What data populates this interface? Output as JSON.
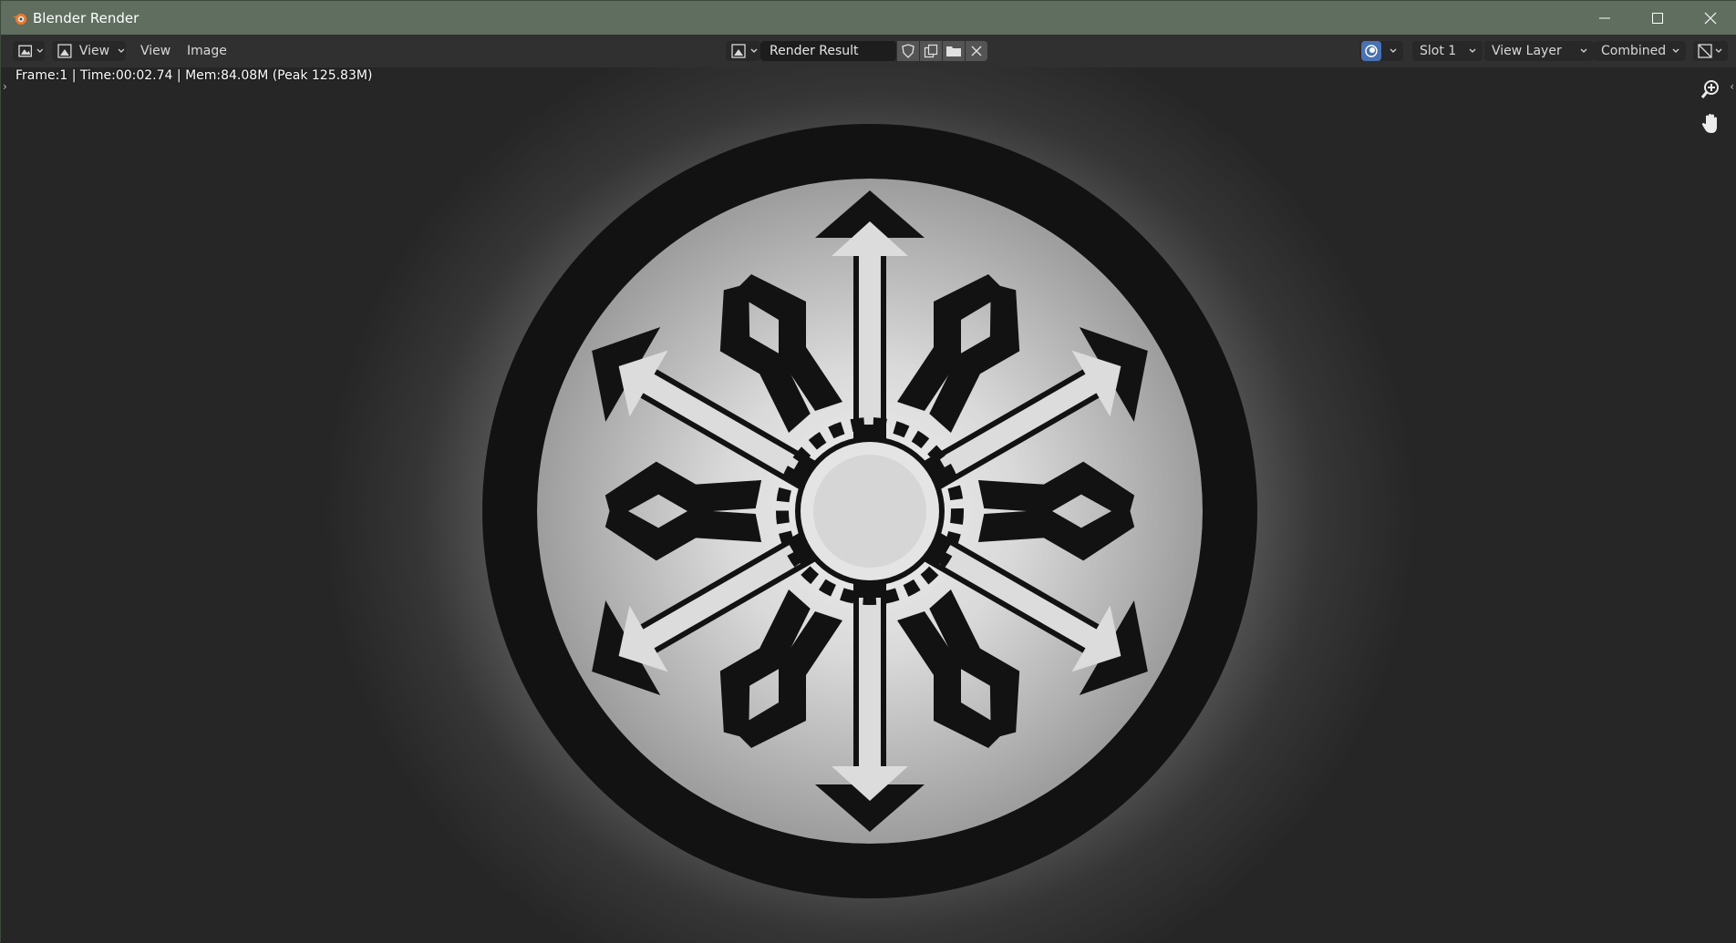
{
  "window": {
    "title": "Blender Render"
  },
  "header": {
    "editor_type_icon": "image-editor-icon",
    "view_mode": "View",
    "menus": [
      "View",
      "Image"
    ],
    "image_name": "Render Result",
    "slot": "Slot 1",
    "view_layer": "View Layer",
    "pass": "Combined"
  },
  "viewport": {
    "stats": "Frame:1 | Time:00:02.74 | Mem:84.08M (Peak 125.83M)"
  },
  "colors": {
    "titlebar": "#5f6e5f",
    "header": "#303030",
    "accent": "#4772b3"
  }
}
